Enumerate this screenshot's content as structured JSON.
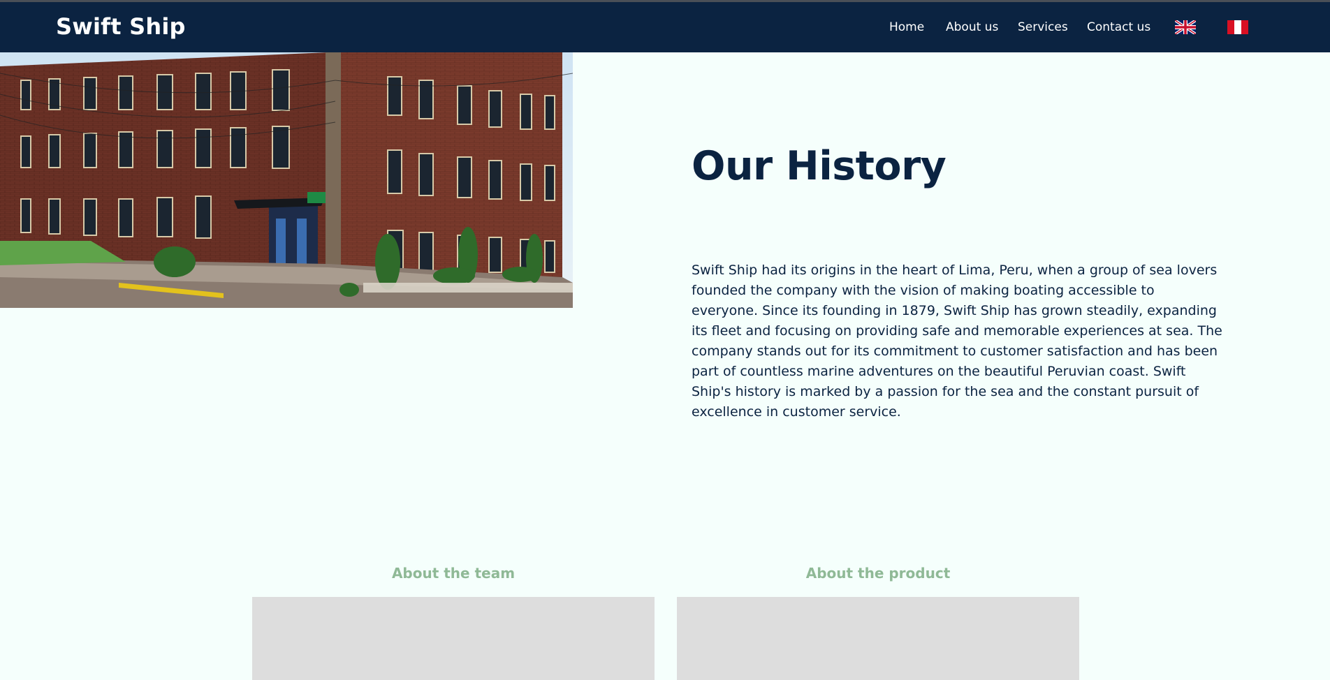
{
  "navbar": {
    "brand": "Swift Ship",
    "links": [
      {
        "label": "Home"
      },
      {
        "label": "About us"
      },
      {
        "label": "Services"
      },
      {
        "label": "Contact us"
      }
    ],
    "flags": [
      "uk-flag-icon",
      "peru-flag-icon"
    ],
    "background_color": "#0b2341"
  },
  "history": {
    "title": "Our History",
    "text": "Swift Ship had its origins in the heart of Lima, Peru, when a group of sea lovers founded the company with the vision of making boating accessible to everyone. Since its founding in 1879, Swift Ship has grown steadily, expanding its fleet and focusing on providing safe and memorable experiences at sea. The company stands out for its commitment to customer satisfaction and has been part of countless marine adventures on the beautiful Peruvian coast. Swift Ship's history is marked by a passion for the sea and the constant pursuit of excellence in customer service."
  },
  "cards": [
    {
      "title": "About the team"
    },
    {
      "title": "About the product"
    }
  ],
  "colors": {
    "page_background": "#f5fffc",
    "accent_green": "#8fb996",
    "card_placeholder": "#dddddd"
  }
}
